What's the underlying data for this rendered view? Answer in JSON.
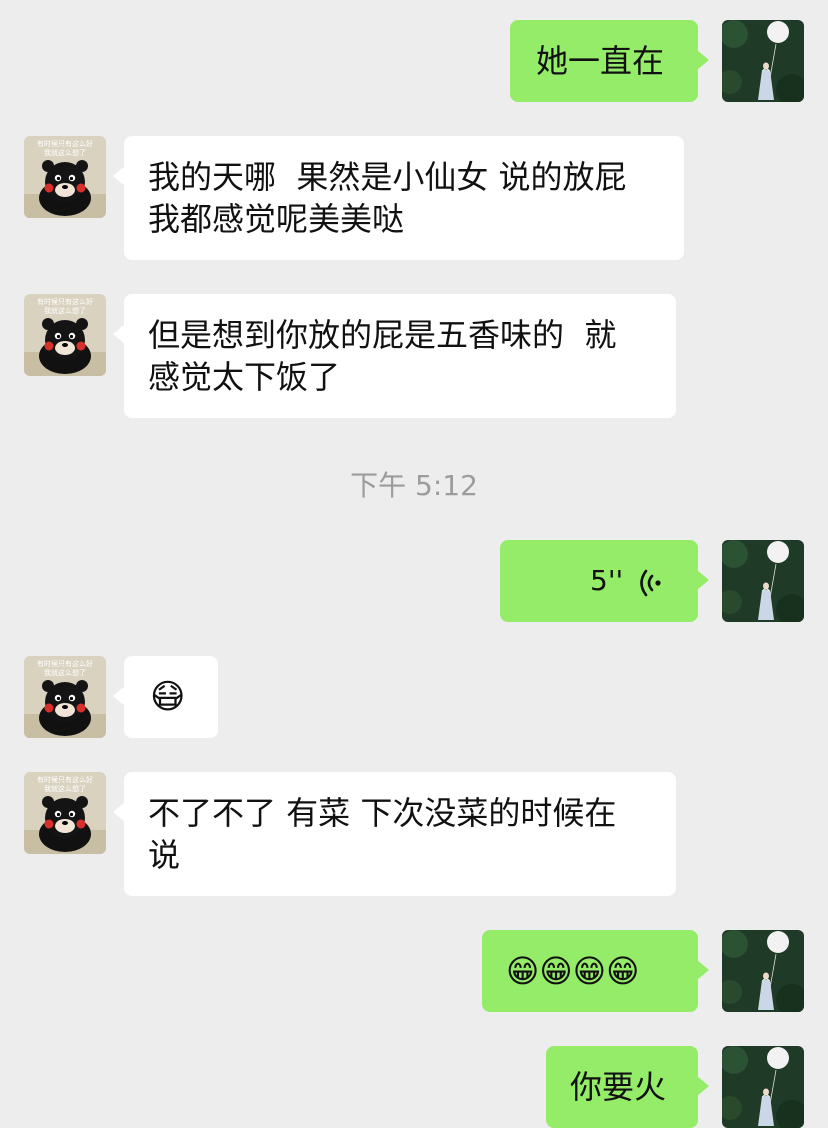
{
  "messages": [
    {
      "side": "right",
      "text": "她一直在"
    },
    {
      "side": "left",
      "text": "我的天哪  果然是小仙女 说的放屁\n我都感觉呢美美哒"
    },
    {
      "side": "left",
      "text": "但是想到你放的屁是五香味的  就\n感觉太下饭了"
    },
    {
      "side": "right",
      "type": "voice",
      "duration": "5''",
      "icon": "voice-wave-icon"
    },
    {
      "side": "left",
      "type": "emoji",
      "emoji": "😷"
    },
    {
      "side": "left",
      "text": "不了不了 有菜 下次没菜的时候在\n说"
    },
    {
      "side": "right",
      "type": "emoji",
      "emoji": "😁😁😁😁"
    },
    {
      "side": "right",
      "text": "你要火"
    }
  ],
  "timestamp": "下午 5:12",
  "avatar_left_caption": "有时候只有我这么想好\n我就这么想了",
  "colors": {
    "background": "#ededed",
    "self_bubble": "#95ec69",
    "other_bubble": "#ffffff",
    "timestamp": "#9c9c9c"
  }
}
